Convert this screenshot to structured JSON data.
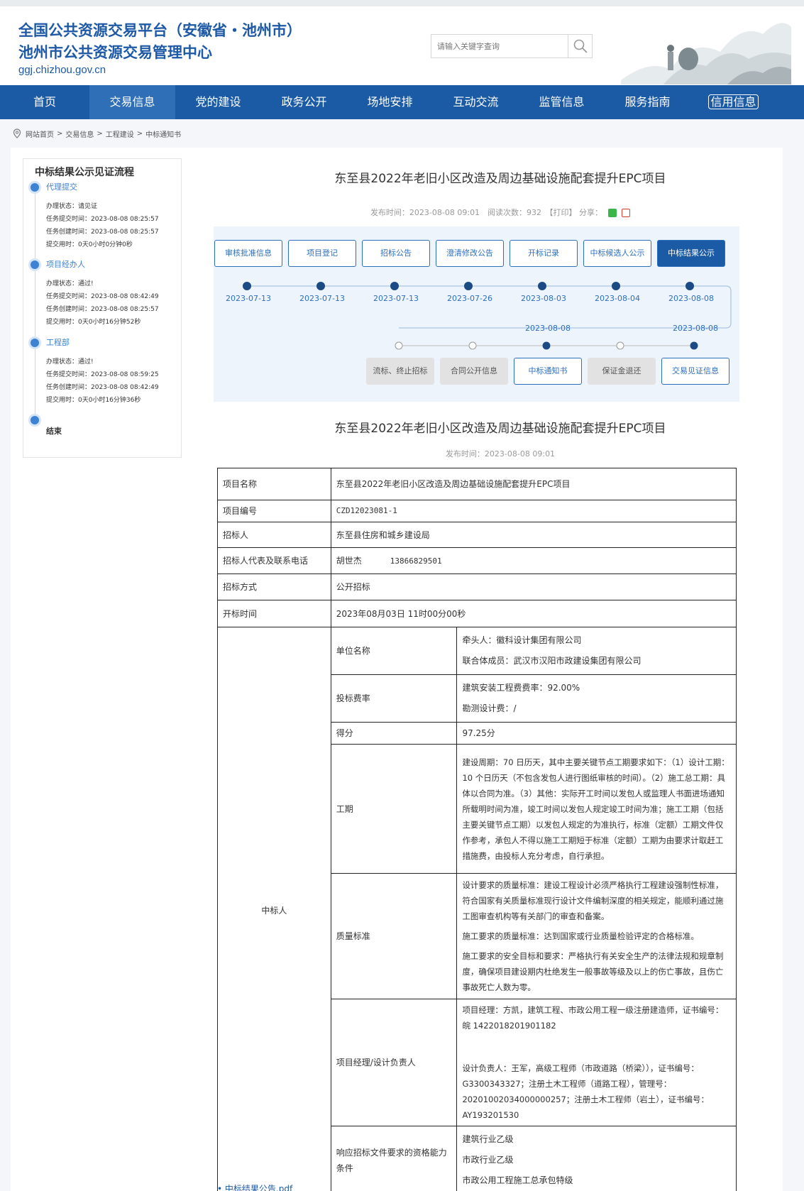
{
  "header": {
    "title_line1": "全国公共资源交易平台（安徽省・池州市）",
    "title_line2": "池州市公共资源交易管理中心",
    "url": "ggj.chizhou.gov.cn",
    "search_placeholder": "请输入关键字查询"
  },
  "nav": [
    "首页",
    "交易信息",
    "党的建设",
    "政务公开",
    "场地安排",
    "互动交流",
    "监管信息",
    "服务指南",
    "信用信息"
  ],
  "breadcrumb": [
    "网站首页",
    "交易信息",
    "工程建设",
    "中标通知书"
  ],
  "sidebar": {
    "title": "中标结果公示见证流程",
    "steps": [
      {
        "name": "代理提交",
        "info": [
          "办理状态：请见证",
          "任务提交时间：2023-08-08 08:25:57",
          "任务创建时间：2023-08-08 08:25:57",
          "提交用时：0天0小时0分钟0秒"
        ]
      },
      {
        "name": "项目经办人",
        "info": [
          "办理状态：通过!",
          "任务提交时间：2023-08-08 08:42:49",
          "任务创建时间：2023-08-08 08:25:57",
          "提交用时：0天0小时16分钟52秒"
        ]
      },
      {
        "name": "工程部",
        "info": [
          "办理状态：通过!",
          "任务提交时间：2023-08-08 08:59:25",
          "任务创建时间：2023-08-08 08:42:49",
          "提交用时：0天0小时16分钟36秒"
        ]
      }
    ],
    "end_label": "结束"
  },
  "article": {
    "title": "东至县2022年老旧小区改造及周边基础设施配套提升EPC项目",
    "meta": "发布时间：2023-08-08 09:01　阅读次数：932　【打印】 分享：",
    "sub_title": "东至县2022年老旧小区改造及周边基础设施配套提升EPC项目",
    "sub_meta": "发布时间：2023-08-08 09:01"
  },
  "flow": {
    "top_buttons": [
      "审核批准信息",
      "项目登记",
      "招标公告",
      "澄清修改公告",
      "开标记录",
      "中标候选人公示",
      "中标结果公示"
    ],
    "top_dates": [
      "2023-07-13",
      "2023-07-13",
      "2023-07-13",
      "2023-07-26",
      "2023-08-03",
      "2023-08-04",
      "2023-08-08"
    ],
    "bottom_buttons": [
      "流标、终止招标",
      "合同公开信息",
      "中标通知书",
      "保证金退还",
      "交易见证信息"
    ],
    "bottom_dates": [
      "",
      "",
      "2023-08-08",
      "",
      "2023-08-08"
    ]
  },
  "table": {
    "project_name_label": "项目名称",
    "project_name": "东至县2022年老旧小区改造及周边基础设施配套提升EPC项目",
    "project_no_label": "项目编号",
    "project_no": "CZD12023081-1",
    "tenderer_label": "招标人",
    "tenderer": "东至县住房和城乡建设局",
    "rep_label": "招标人代表及联系电话",
    "rep_name": "胡世杰",
    "rep_phone": "13866829501",
    "method_label": "招标方式",
    "method": "公开招标",
    "open_time_label": "开标时间",
    "open_time": "2023年08月03日 11时00分00秒",
    "winner_label": "中标人",
    "unit_label": "单位名称",
    "unit_lines": [
      "牵头人：徽科设计集团有限公司",
      "联合体成员：武汉市汉阳市政建设集团有限公司"
    ],
    "rate_label": "投标费率",
    "rate_lines": [
      "建筑安装工程费费率：92.00%",
      "勘测设计费：/"
    ],
    "score_label": "得分",
    "score": "97.25分",
    "period_label": "工期",
    "period_text": "建设周期：70 日历天，其中主要关键节点工期要求如下：（1）设计工期：10 个日历天（不包含发包人进行图纸审核的时间）。（2）施工总工期：具体以合同为准。（3）其他：实际开工时间以发包人或监理人书面进场通知所载明时间为准，竣工时间以发包人规定竣工时间为准；施工工期（包括主要关键节点工期）以发包人规定的为准执行，标准（定额）工期文件仅作参考，承包人不得以施工工期短于标准（定额）工期为由要求计取赶工措施费，由投标人充分考虑，自行承担。",
    "quality_label": "质量标准",
    "quality_lines": [
      "设计要求的质量标准：建设工程设计必须严格执行工程建设强制性标准，符合国家有关质量标准现行设计文件编制深度的相关规定，能顺利通过施工图审查机构等有关部门的审查和备案。",
      "施工要求的质量标准：达到国家或行业质量检验评定的合格标准。",
      "施工要求的安全目标和要求：严格执行有关安全生产的法律法规和规章制度，确保项目建设期内杜绝发生一般事故等级及以上的伤亡事故，且伤亡事故死亡人数为零。"
    ],
    "manager_label": "项目经理/设计负责人",
    "manager_lines": [
      "项目经理：方凯，建筑工程、市政公用工程一级注册建造师，证书编号：皖 1422018201901182",
      "设计负责人：王军，高级工程师（市政道路（桥梁）），证书编号：G3300343327；注册土木工程师（道路工程），管理号：20201002034000000257；注册土木工程师（岩土），证书编号：AY193201530"
    ],
    "qual_label": "响应招标文件要求的资格能力条件",
    "qual_lines": [
      "建筑行业乙级",
      "市政行业乙级",
      "市政公用工程施工总承包特级"
    ]
  },
  "attachment": "中标结果公告.pdf"
}
